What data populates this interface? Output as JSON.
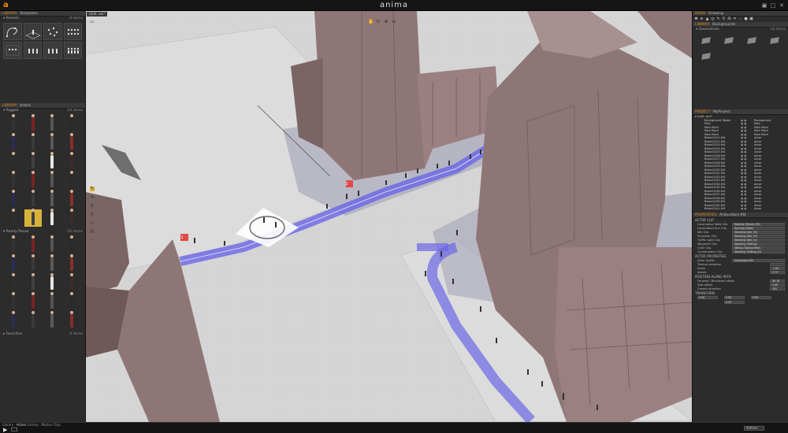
{
  "app": {
    "title": "anima"
  },
  "left_panel": {
    "templates": {
      "header_tag": "LIBRARY",
      "header_title": "Templates",
      "section": "Presets",
      "section_count": "8 items",
      "icons": [
        "curve-path-icon",
        "crowd-on-platform-icon",
        "scattered-crowd-icon",
        "crowd-grid-icon",
        "crowd-selection-icon",
        "crowd-row-icon",
        "crowd-row-icon",
        "crowd-grid-icon"
      ]
    },
    "actors": {
      "header_tag": "LIBRARY",
      "header_title": "Actors",
      "rigged_section": "Rigged",
      "rigged_count": "24 items",
      "ready_posed_section": "Ready-Posed",
      "ready_posed_count": "24 items",
      "favorites_section": "Favorites",
      "favorites_count": "0 items"
    }
  },
  "bottom_bar": {
    "tabs": [
      "Library",
      "Actors",
      "Library",
      "Motion Clips"
    ],
    "right_label": "Actions"
  },
  "viewport": {
    "tab_label": "Untit. ani*",
    "markers": [
      "1",
      "2"
    ]
  },
  "right_panel": {
    "mode": {
      "tag": "MODE",
      "title": "Drawing"
    },
    "backgrounds": {
      "tag": "LIBRARY",
      "title": "Backgrounds",
      "section": "Geometries",
      "count": "18 items"
    },
    "project": {
      "tag": "PROJECT",
      "title": "MyProject",
      "root": "Untit. ani*",
      "items": [
        {
          "name": "Background Model",
          "type": "Background"
        },
        {
          "name": "Path",
          "type": "Path"
        },
        {
          "name": "Path Point",
          "type": "Path Point"
        },
        {
          "name": "Path Point",
          "type": "Path Point"
        },
        {
          "name": "Path Point",
          "type": "Path Point"
        },
        {
          "name": "Bitoni0221-M4",
          "type": "Actor"
        },
        {
          "name": "Bitoni0222-M4",
          "type": "Actor"
        },
        {
          "name": "Bitoni0223-M4",
          "type": "Actor"
        },
        {
          "name": "Bitoni0224-M4",
          "type": "Actor"
        },
        {
          "name": "Bitoni0225-M4",
          "type": "Actor"
        },
        {
          "name": "Bitoni0226-M4",
          "type": "Actor"
        },
        {
          "name": "Bitoni0227-M4",
          "type": "Actor"
        },
        {
          "name": "Bitoni0228-M4",
          "type": "Actor"
        },
        {
          "name": "Bitoni0229-M4",
          "type": "Actor"
        },
        {
          "name": "Bitoni0230-M4",
          "type": "Actor"
        },
        {
          "name": "Bitoni0231-M4",
          "type": "Actor"
        },
        {
          "name": "Bitoni0232-M4",
          "type": "Actor"
        },
        {
          "name": "Bitoni0233-M4",
          "type": "Actor"
        },
        {
          "name": "Bitoni0234-M4",
          "type": "Actor"
        },
        {
          "name": "Bitoni0235-M4",
          "type": "Actor"
        },
        {
          "name": "Bitoni0236-M4",
          "type": "Actor"
        },
        {
          "name": "Bitoni0237-M4",
          "type": "Actor"
        },
        {
          "name": "Bitoni0238-M4",
          "type": "Actor"
        },
        {
          "name": "Bitoni0239-M4",
          "type": "Actor"
        },
        {
          "name": "Bitoni0240-M4",
          "type": "Actor"
        },
        {
          "name": "Bitoni0241-M4",
          "type": "Actor"
        }
      ]
    },
    "properties": {
      "tag": "PROPERTIES",
      "title": "Anibuddoni-M4",
      "actor_clip_section": "ACTOR CLIP",
      "clips": [
        {
          "label": "Locomotion Walk Clip",
          "value": "Walking (Tensen_60)"
        },
        {
          "label": "Locomotion Run Clip",
          "value": "Running (Male)"
        },
        {
          "label": "Idle Clip",
          "value": "Standing (Idle_03)"
        },
        {
          "label": "Escalator Clip",
          "value": "Standing (Idle_03)"
        },
        {
          "label": "Traffic Light Clip",
          "value": "Standing (Idle_01)"
        },
        {
          "label": "Waypoint Clip",
          "value": "Standing (Talking)"
        },
        {
          "label": "Chair Clip",
          "value": "Sitting (Talking Male)"
        },
        {
          "label": "Conversation Clip",
          "value": "Standing (Talking_02)"
        }
      ],
      "actor_properties_section": "ACTOR PROPERTIES",
      "actor_model_label": "Actor model",
      "actor_model_value": "Anibuddoni-M4",
      "actor_rows": [
        {
          "label": "Texture variation",
          "value": ""
        },
        {
          "label": "Scale",
          "value": "-1.00"
        },
        {
          "label": "Speed",
          "value": "0.75"
        }
      ],
      "path_section": "POSITION ALONG PATH",
      "path_rows": [
        {
          "label": "Forward / Backward offset",
          "value": "55.16"
        },
        {
          "label": "Side offset",
          "value": "0.49"
        },
        {
          "label": "Growth direction",
          "value": "YES"
        }
      ],
      "transform_section": "TRANSFORM",
      "position": {
        "x": "0.00",
        "y": "0.00",
        "z": "0.00"
      },
      "rotation": "0.00"
    }
  },
  "colors": {
    "accent": "#e08a20",
    "path": "#6b67e6",
    "building": "#8f7676",
    "marker": "#e04a4a"
  }
}
